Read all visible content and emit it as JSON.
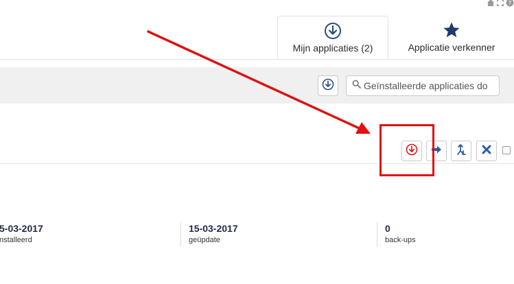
{
  "header": {
    "icons": [
      "home-icon",
      "expand-icon",
      "help-icon"
    ]
  },
  "tabs": [
    {
      "label": "Mijn applicaties (2)",
      "icon": "download-circle-icon",
      "active": true
    },
    {
      "label": "Applicatie verkenner",
      "icon": "star-icon",
      "active": false
    }
  ],
  "toolbar": {
    "download_icon": "download-circle-icon",
    "search_placeholder": "Geïnstalleerde applicaties do"
  },
  "app_row": {
    "actions": [
      {
        "name": "download-button",
        "icon": "download-circle-icon",
        "color": "#e01010"
      },
      {
        "name": "arrow-right-button",
        "icon": "arrow-right-icon",
        "color": "#2a5aa8"
      },
      {
        "name": "branch-button",
        "icon": "branch-icon",
        "color": "#2a5aa8"
      },
      {
        "name": "delete-button",
        "icon": "close-icon",
        "color": "#2a5aa8"
      }
    ],
    "stats": [
      {
        "value": "5-03-2017",
        "label": "nstalleerd"
      },
      {
        "value": "15-03-2017",
        "label": "geüpdate"
      },
      {
        "value": "0",
        "label": "back-ups"
      }
    ]
  },
  "colors": {
    "accent_blue": "#2a4a7f",
    "annotation_red": "#e01010",
    "toolbar_bg": "#f0f0f0"
  }
}
